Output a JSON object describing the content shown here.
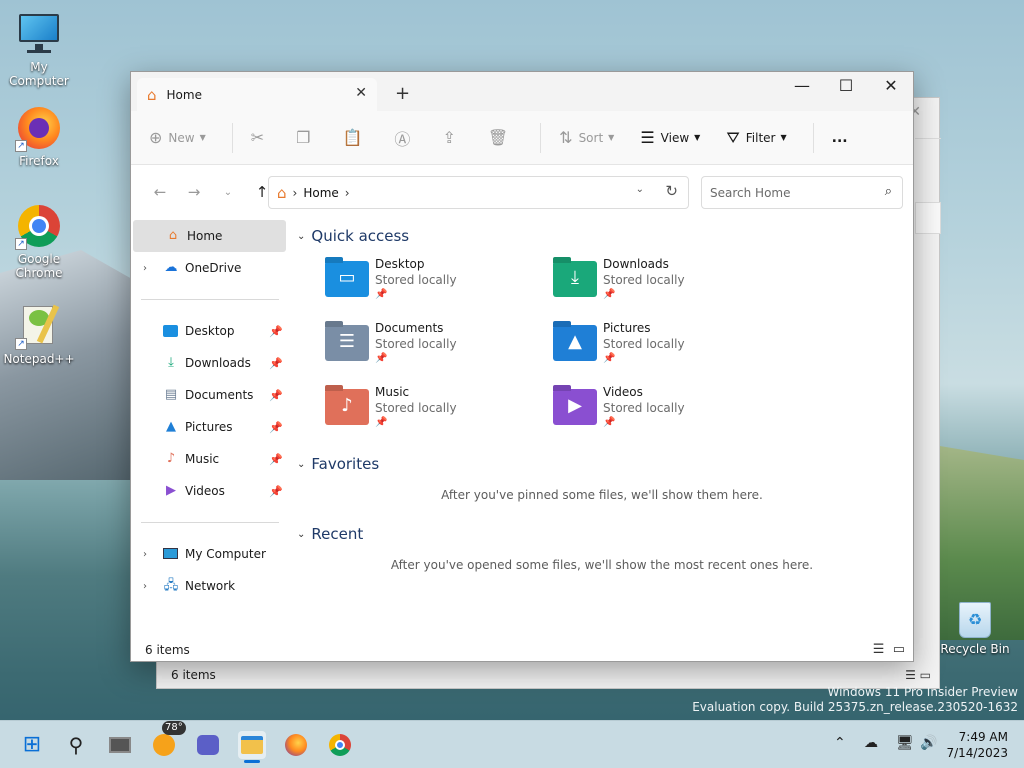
{
  "desktop": {
    "icons": [
      {
        "label": "My Computer"
      },
      {
        "label": "Firefox"
      },
      {
        "label": "Google Chrome"
      },
      {
        "label": "Notepad++"
      },
      {
        "label": "Recycle Bin"
      }
    ],
    "watermark_line1": "Windows 11 Pro Insider Preview",
    "watermark_line2": "Evaluation copy. Build 25375.zn_release.230520-1632"
  },
  "bg_window": {
    "status": "6 items"
  },
  "explorer": {
    "tab_label": "Home",
    "toolbar": {
      "new": "New",
      "sort": "Sort",
      "view": "View",
      "filter": "Filter",
      "more": "..."
    },
    "address": {
      "crumb": "Home"
    },
    "search": {
      "placeholder": "Search Home"
    },
    "nav": {
      "home": "Home",
      "onedrive": "OneDrive",
      "pinned": [
        "Desktop",
        "Downloads",
        "Documents",
        "Pictures",
        "Music",
        "Videos"
      ],
      "my_computer": "My Computer",
      "network": "Network"
    },
    "quick_access": {
      "title": "Quick access",
      "items": [
        {
          "name": "Desktop",
          "sub": "Stored locally",
          "color": "#1a8fe0"
        },
        {
          "name": "Downloads",
          "sub": "Stored locally",
          "color": "#1aa87a"
        },
        {
          "name": "Documents",
          "sub": "Stored locally",
          "color": "#7a8ea6"
        },
        {
          "name": "Pictures",
          "sub": "Stored locally",
          "color": "#1f7fd6"
        },
        {
          "name": "Music",
          "sub": "Stored locally",
          "color": "#e0705a"
        },
        {
          "name": "Videos",
          "sub": "Stored locally",
          "color": "#8a4fd1"
        }
      ]
    },
    "favorites": {
      "title": "Favorites",
      "empty": "After you've pinned some files, we'll show them here."
    },
    "recent": {
      "title": "Recent",
      "empty": "After you've opened some files, we'll show the most recent ones here."
    },
    "status": "6 items"
  },
  "taskbar": {
    "badge": "78°",
    "time": "7:49 AM",
    "date": "7/14/2023"
  }
}
